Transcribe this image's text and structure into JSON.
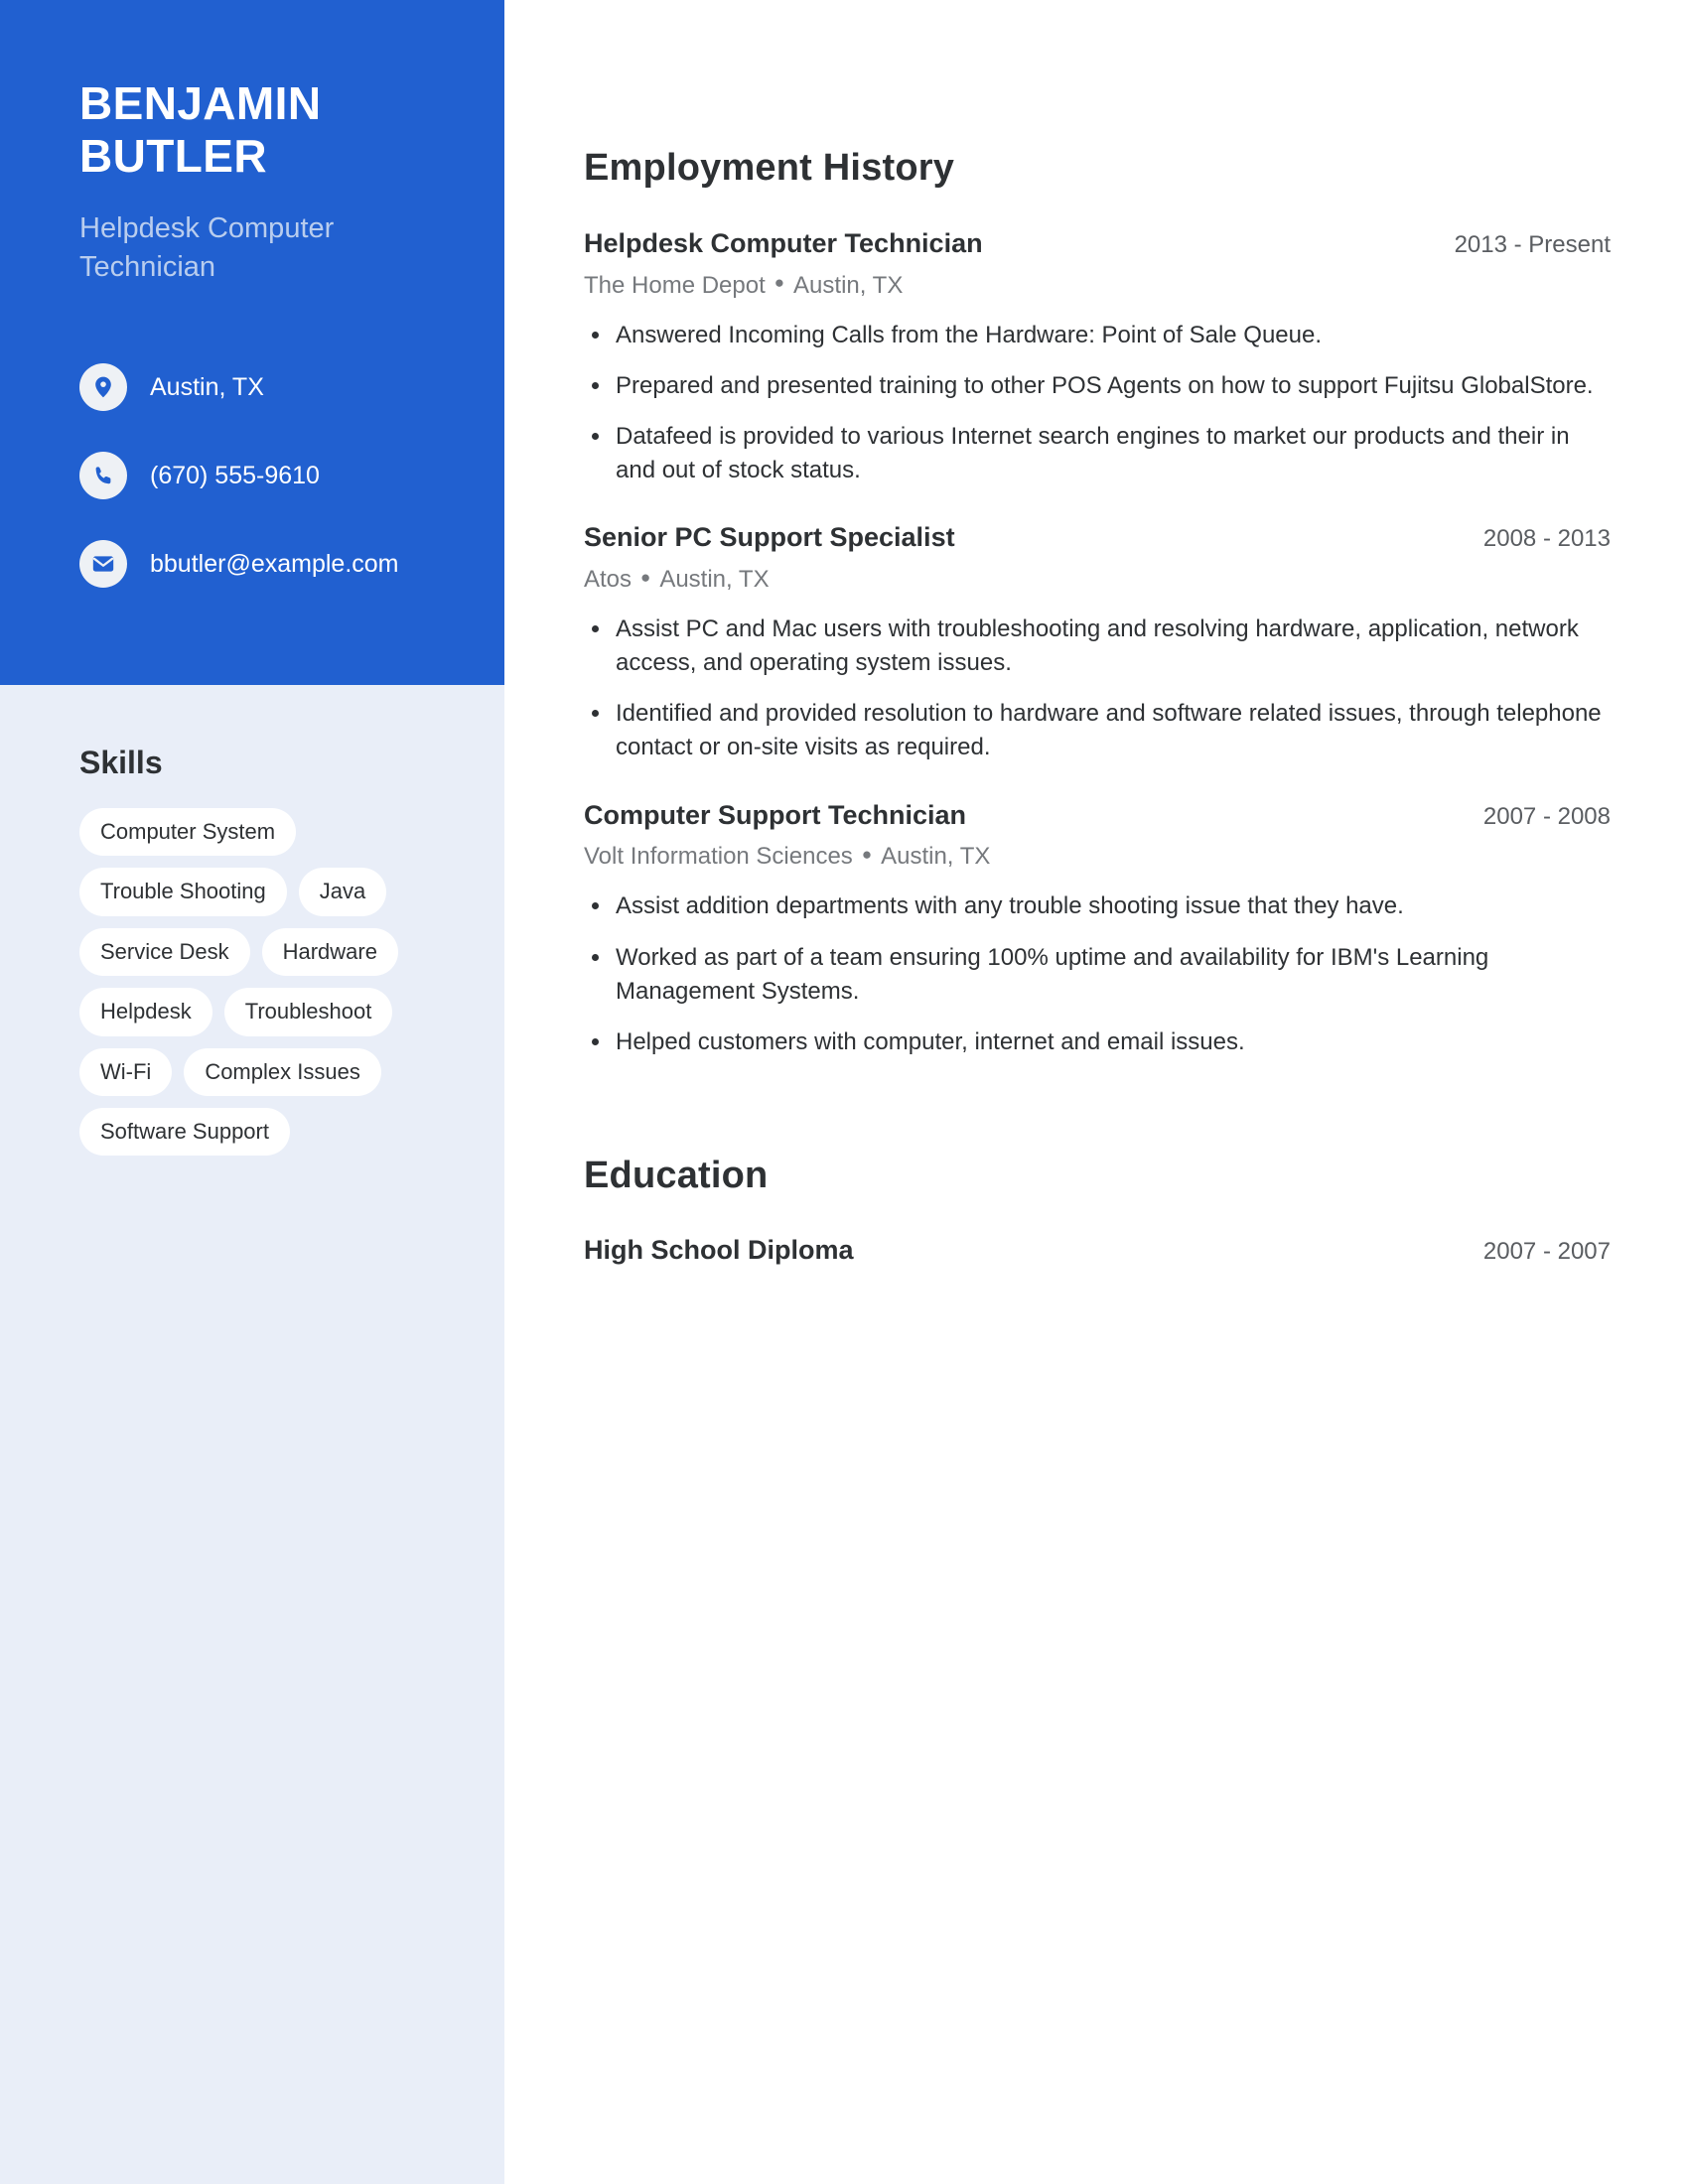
{
  "theme": {
    "accent": "#2160D0",
    "sidebar_bg": "#E9EEF8",
    "text": "#2E3134",
    "muted": "#76797D",
    "subtitle": "#B9CDEE"
  },
  "sidebar": {
    "name_line1": "BENJAMIN",
    "name_line2": "BUTLER",
    "job_title": "Helpdesk Computer Technician",
    "contacts": [
      {
        "icon": "location-pin-icon",
        "value": "Austin, TX"
      },
      {
        "icon": "phone-icon",
        "value": "(670) 555-9610"
      },
      {
        "icon": "envelope-icon",
        "value": "bbutler@example.com"
      }
    ],
    "skills_heading": "Skills",
    "skills": [
      "Computer System",
      "Trouble Shooting",
      "Java",
      "Service Desk",
      "Hardware",
      "Helpdesk",
      "Troubleshoot",
      "Wi-Fi",
      "Complex Issues",
      "Software Support"
    ]
  },
  "main": {
    "employment_heading": "Employment History",
    "education_heading": "Education",
    "separator": "●",
    "jobs": [
      {
        "role": "Helpdesk Computer Technician",
        "dates": "2013 - Present",
        "company": "The Home Depot",
        "location": "Austin, TX",
        "bullets": [
          "Answered Incoming Calls from the Hardware: Point of Sale Queue.",
          "Prepared and presented training to other POS Agents on how to support Fujitsu GlobalStore.",
          "Datafeed is provided to various Internet search engines to market our products and their in and out of stock status."
        ]
      },
      {
        "role": "Senior PC Support Specialist",
        "dates": "2008 - 2013",
        "company": "Atos",
        "location": "Austin, TX",
        "bullets": [
          "Assist PC and Mac users with troubleshooting and resolving hardware, application, network access, and operating system issues.",
          "Identified and provided resolution to hardware and software related issues, through telephone contact or on-site visits as required."
        ]
      },
      {
        "role": "Computer Support Technician",
        "dates": "2007 - 2008",
        "company": "Volt Information Sciences",
        "location": "Austin, TX",
        "bullets": [
          "Assist addition departments with any trouble shooting issue that they have.",
          "Worked as part of a team ensuring 100% uptime and availability for IBM's Learning Management Systems.",
          "Helped customers with computer, internet and email issues."
        ]
      }
    ],
    "education": [
      {
        "degree": "High School Diploma",
        "dates": "2007 - 2007"
      }
    ]
  }
}
